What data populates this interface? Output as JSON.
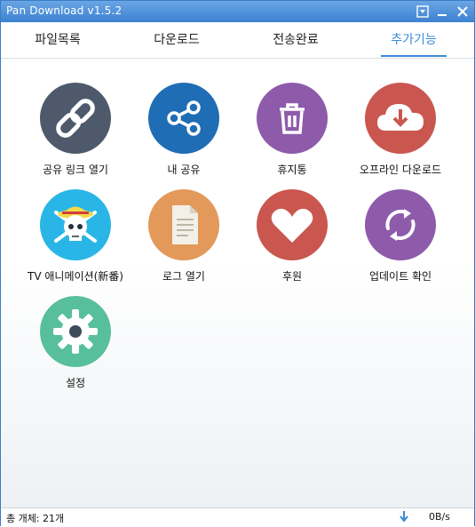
{
  "window": {
    "title": "Pan Download v1.5.2"
  },
  "tabs": [
    {
      "label": "파일목록"
    },
    {
      "label": "다운로드"
    },
    {
      "label": "전송완료"
    },
    {
      "label": "추가기능"
    }
  ],
  "active_tab": "추가기능",
  "features": [
    {
      "label": "공유 링크 열기",
      "icon": "link-icon",
      "color": "#4e5a6c"
    },
    {
      "label": "내 공유",
      "icon": "share-icon",
      "color": "#1f6db4"
    },
    {
      "label": "휴지통",
      "icon": "trash-icon",
      "color": "#8e5bab"
    },
    {
      "label": "오프라인 다운로드",
      "icon": "cloud-download-icon",
      "color": "#c9574f"
    },
    {
      "label": "TV 애니메이션(新番)",
      "icon": "skull-icon",
      "color": "#29b6e6"
    },
    {
      "label": "로그 열기",
      "icon": "document-icon",
      "color": "#e2995a"
    },
    {
      "label": "후원",
      "icon": "heart-icon",
      "color": "#c9574f"
    },
    {
      "label": "업데이트 확인",
      "icon": "refresh-icon",
      "color": "#8e5bab"
    },
    {
      "label": "설정",
      "icon": "gear-icon",
      "color": "#57bf9c"
    }
  ],
  "status": {
    "total": "총 개체: 21개",
    "speed": "0B/s"
  },
  "colors": {
    "accent": "#3a8ad8",
    "titlebar": "#3c82d2"
  }
}
